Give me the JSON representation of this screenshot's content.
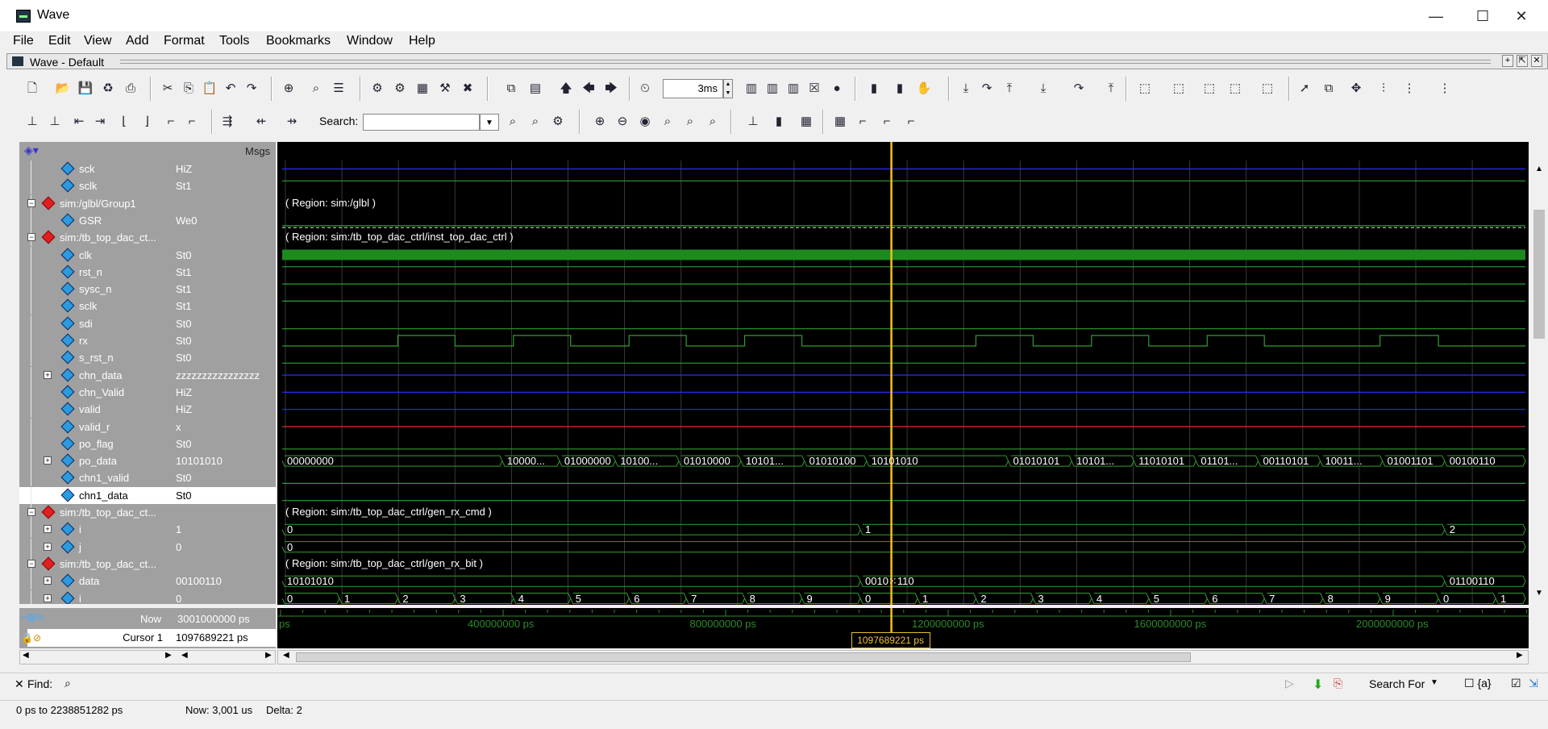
{
  "window": {
    "title": "Wave",
    "minimize": "—",
    "maximize": "☐",
    "close": "✕"
  },
  "menu": [
    "File",
    "Edit",
    "View",
    "Add",
    "Format",
    "Tools",
    "Bookmarks",
    "Window",
    "Help"
  ],
  "dock": {
    "title": "Wave - Default"
  },
  "toolbar": {
    "time_value": "3ms",
    "search_label": "Search:",
    "search_value": ""
  },
  "panel": {
    "msgs_header": "Msgs"
  },
  "signals": [
    {
      "name": "sck",
      "value": "HiZ",
      "indent": 2,
      "kind": "sig",
      "expand": ""
    },
    {
      "name": "sclk",
      "value": "St1",
      "indent": 2,
      "kind": "sig",
      "expand": ""
    },
    {
      "name": "sim:/glbl/Group1",
      "value": "",
      "indent": 0,
      "kind": "group",
      "expand": "−"
    },
    {
      "name": "GSR",
      "value": "We0",
      "indent": 2,
      "kind": "sig",
      "expand": ""
    },
    {
      "name": "sim:/tb_top_dac_ct...",
      "value": "",
      "indent": 0,
      "kind": "group",
      "expand": "−"
    },
    {
      "name": "clk",
      "value": "St0",
      "indent": 2,
      "kind": "in",
      "expand": ""
    },
    {
      "name": "rst_n",
      "value": "St1",
      "indent": 2,
      "kind": "in",
      "expand": ""
    },
    {
      "name": "sysc_n",
      "value": "St1",
      "indent": 2,
      "kind": "sig",
      "expand": ""
    },
    {
      "name": "sclk",
      "value": "St1",
      "indent": 2,
      "kind": "in",
      "expand": ""
    },
    {
      "name": "sdi",
      "value": "St0",
      "indent": 2,
      "kind": "in",
      "expand": ""
    },
    {
      "name": "rx",
      "value": "St0",
      "indent": 2,
      "kind": "in",
      "expand": ""
    },
    {
      "name": "s_rst_n",
      "value": "St0",
      "indent": 2,
      "kind": "sig",
      "expand": ""
    },
    {
      "name": "chn_data",
      "value": "zzzzzzzzzzzzzzzz",
      "indent": 2,
      "kind": "sig",
      "expand": "+"
    },
    {
      "name": "chn_Valid",
      "value": "HiZ",
      "indent": 2,
      "kind": "sig",
      "expand": ""
    },
    {
      "name": "valid",
      "value": "HiZ",
      "indent": 2,
      "kind": "sig",
      "expand": ""
    },
    {
      "name": "valid_r",
      "value": "x",
      "indent": 2,
      "kind": "sig",
      "expand": ""
    },
    {
      "name": "po_flag",
      "value": "St0",
      "indent": 2,
      "kind": "sig",
      "expand": ""
    },
    {
      "name": "po_data",
      "value": "10101010",
      "indent": 2,
      "kind": "sig",
      "expand": "+"
    },
    {
      "name": "chn1_valid",
      "value": "St0",
      "indent": 2,
      "kind": "sig",
      "expand": ""
    },
    {
      "name": "chn1_data",
      "value": "St0",
      "indent": 2,
      "kind": "sig",
      "expand": "",
      "selected": true
    },
    {
      "name": "sim:/tb_top_dac_ct...",
      "value": "",
      "indent": 0,
      "kind": "group",
      "expand": "−"
    },
    {
      "name": "i",
      "value": "1",
      "indent": 2,
      "kind": "sig",
      "expand": "+"
    },
    {
      "name": "j",
      "value": "0",
      "indent": 2,
      "kind": "sig",
      "expand": "+"
    },
    {
      "name": "sim:/tb_top_dac_ct...",
      "value": "",
      "indent": 0,
      "kind": "group",
      "expand": "−"
    },
    {
      "name": "data",
      "value": "00100110",
      "indent": 2,
      "kind": "sig",
      "expand": "+"
    },
    {
      "name": "i",
      "value": "0",
      "indent": 2,
      "kind": "sig",
      "expand": "+"
    }
  ],
  "regions": {
    "glbl": "( Region: sim:/glbl )",
    "inst": "( Region: sim:/tb_top_dac_ctrl/inst_top_dac_ctrl )",
    "cmd": "( Region: sim:/tb_top_dac_ctrl/gen_rx_cmd )",
    "bit": "( Region: sim:/tb_top_dac_ctrl/gen_rx_bit )"
  },
  "po_data_values": [
    {
      "t": 0.0,
      "v": "00000000"
    },
    {
      "t": 0.177,
      "v": "10000..."
    },
    {
      "t": 0.223,
      "v": "01000000"
    },
    {
      "t": 0.268,
      "v": "10100..."
    },
    {
      "t": 0.319,
      "v": "01010000"
    },
    {
      "t": 0.369,
      "v": "10101..."
    },
    {
      "t": 0.42,
      "v": "01010100"
    },
    {
      "t": 0.47,
      "v": "10101010"
    },
    {
      "t": 0.584,
      "v": "01010101"
    },
    {
      "t": 0.635,
      "v": "10101..."
    },
    {
      "t": 0.685,
      "v": "11010101"
    },
    {
      "t": 0.735,
      "v": "01101..."
    },
    {
      "t": 0.785,
      "v": "00110101"
    },
    {
      "t": 0.835,
      "v": "10011..."
    },
    {
      "t": 0.885,
      "v": "01001101"
    },
    {
      "t": 0.935,
      "v": "00100110"
    }
  ],
  "i_values": [
    {
      "t": 0.0,
      "v": "0"
    },
    {
      "t": 0.465,
      "v": "1"
    },
    {
      "t": 0.935,
      "v": "2"
    }
  ],
  "j_values": [
    {
      "t": 0.0,
      "v": "0"
    }
  ],
  "data_values": [
    {
      "t": 0.0,
      "v": "10101010"
    },
    {
      "t": 0.465,
      "v": "0010⁙110"
    },
    {
      "t": 0.935,
      "v": "01100110"
    }
  ],
  "bit_i_values": [
    {
      "t": 0.0,
      "v": "0"
    },
    {
      "t": 0.046,
      "v": "1"
    },
    {
      "t": 0.093,
      "v": "2"
    },
    {
      "t": 0.139,
      "v": "3"
    },
    {
      "t": 0.186,
      "v": "4"
    },
    {
      "t": 0.232,
      "v": "5"
    },
    {
      "t": 0.279,
      "v": "6"
    },
    {
      "t": 0.325,
      "v": "7"
    },
    {
      "t": 0.372,
      "v": "8"
    },
    {
      "t": 0.418,
      "v": "9"
    },
    {
      "t": 0.465,
      "v": "0"
    },
    {
      "t": 0.511,
      "v": "1"
    },
    {
      "t": 0.558,
      "v": "2"
    },
    {
      "t": 0.604,
      "v": "3"
    },
    {
      "t": 0.651,
      "v": "4"
    },
    {
      "t": 0.697,
      "v": "5"
    },
    {
      "t": 0.744,
      "v": "6"
    },
    {
      "t": 0.79,
      "v": "7"
    },
    {
      "t": 0.837,
      "v": "8"
    },
    {
      "t": 0.883,
      "v": "9"
    },
    {
      "t": 0.93,
      "v": "0"
    },
    {
      "t": 0.976,
      "v": "1"
    }
  ],
  "rx_pulses": [
    [
      0.093,
      0.139
    ],
    [
      0.186,
      0.232
    ],
    [
      0.279,
      0.325
    ],
    [
      0.372,
      0.418
    ],
    [
      0.558,
      0.604
    ],
    [
      0.651,
      0.697
    ],
    [
      0.744,
      0.79
    ],
    [
      0.883,
      0.93
    ]
  ],
  "cursor_fraction": 0.49,
  "timeline": {
    "now_label": "Now",
    "now_value": "3001000000 ps",
    "cursor_label": "Cursor 1",
    "cursor_value": "1097689221 ps",
    "ticks": [
      "ps",
      "400000000 ps",
      "800000000 ps",
      "1200000000 ps",
      "1600000000 ps",
      "2000000000 ps"
    ],
    "cursor_box": "1097689221 ps"
  },
  "find": {
    "label": "Find:",
    "search_for": "Search For"
  },
  "status": {
    "range": "0 ps to 2238851282 ps",
    "now": "Now: 3,001 us",
    "delta": "Delta: 2"
  },
  "colors": {
    "green": "#2f9e2f",
    "bright_green": "#00ff00",
    "blue": "#2b2bff",
    "red": "#e03030",
    "cursor": "#f0c020",
    "grid": "#3a3a3a"
  }
}
